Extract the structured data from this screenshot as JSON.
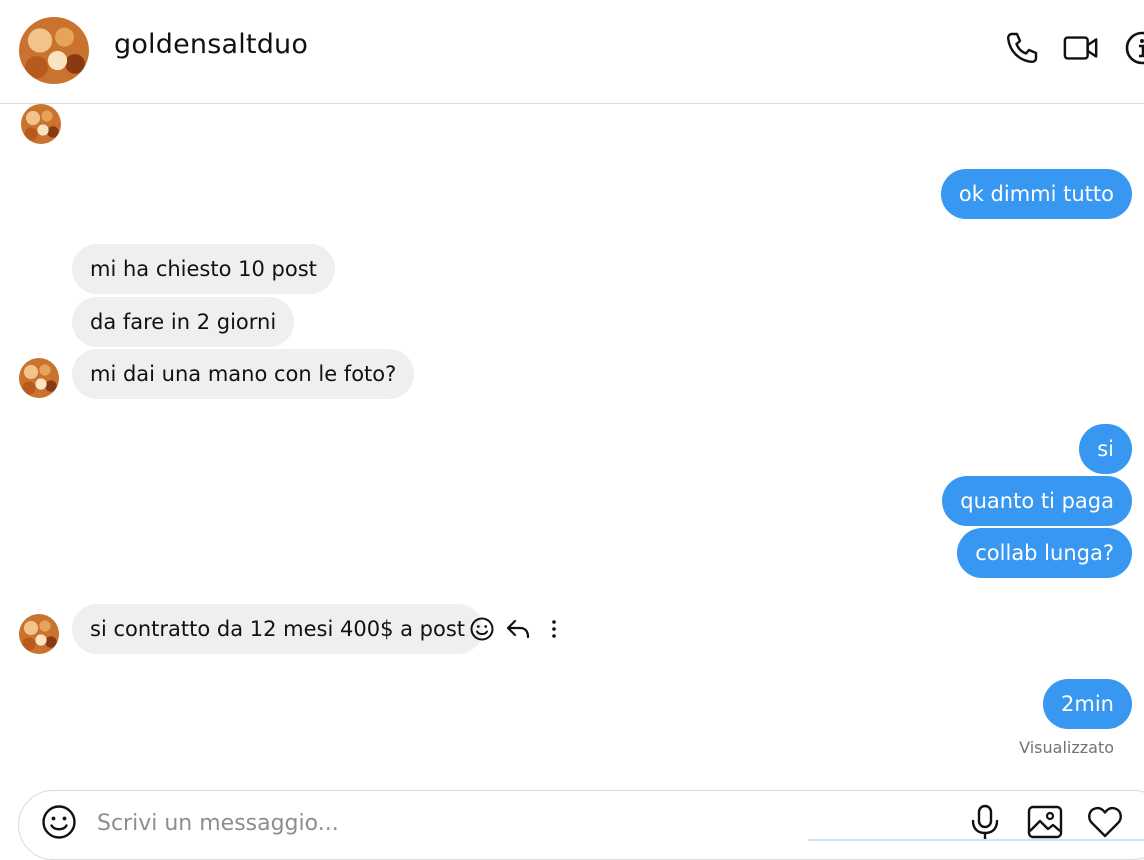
{
  "header": {
    "username": "goldensaltduo",
    "icons": [
      "phone-icon",
      "video-call-icon",
      "info-icon"
    ]
  },
  "messages": {
    "m1": "ok dimmi tutto",
    "m2": "mi ha chiesto 10 post",
    "m3": "da fare in 2 giorni",
    "m4": "mi dai una mano con le foto?",
    "m5": "si",
    "m6": "quanto ti paga",
    "m7": "collab lunga?",
    "m8": "si contratto da 12 mesi 400$ a post",
    "m9": "2min"
  },
  "message_actions": [
    "emoji-react-icon",
    "reply-icon",
    "more-options-icon"
  ],
  "seen_status": "Visualizzato",
  "composer": {
    "placeholder": "Scrivi un messaggio...",
    "icons": [
      "emoji-icon",
      "microphone-icon",
      "image-icon",
      "heart-icon"
    ]
  },
  "colors": {
    "outgoing_bubble": "#3897f0",
    "incoming_bubble": "#efefef"
  }
}
